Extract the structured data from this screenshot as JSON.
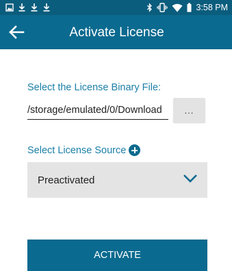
{
  "status_bar": {
    "time": "3:58 PM",
    "left_icons": [
      "image-icon",
      "download-icon",
      "download-icon",
      "download-icon"
    ],
    "right_icons": [
      "bluetooth-icon",
      "vibrate-icon",
      "wifi-icon",
      "battery-icon"
    ]
  },
  "app_bar": {
    "title": "Activate License",
    "back_icon": "arrow-left-icon"
  },
  "file_section": {
    "label": "Select the License Binary File:",
    "path_value": "/storage/emulated/0/Download",
    "browse_label": "..."
  },
  "source_section": {
    "label": "Select License Source",
    "add_icon": "plus-circle-icon",
    "selected": "Preactivated"
  },
  "actions": {
    "activate_label": "ACTIVATE"
  },
  "colors": {
    "status_bar": "#0a5d7d",
    "primary": "#0b6a8f",
    "label_blue": "#1c7fa8",
    "select_bg": "#e4e4e4"
  }
}
